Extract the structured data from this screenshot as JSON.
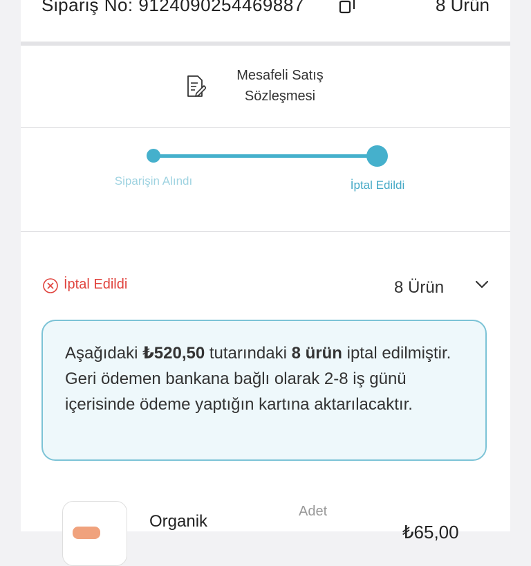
{
  "order": {
    "number_label": "Sipariş No: 9124090254469887",
    "item_count": "8 Ürün",
    "copy_icon": "copy-icon"
  },
  "contract": {
    "icon": "document-edit-icon",
    "label": "Mesafeli Satış Sözleşmesi"
  },
  "progress": {
    "step1": "Siparişin Alındı",
    "step2": "İptal Edildi",
    "accent": "#45b0cc"
  },
  "status": {
    "icon": "cancel-circle-icon",
    "label": "İptal Edildi",
    "count": "8 Ürün",
    "chevron_icon": "chevron-down-icon",
    "color": "#e0433d"
  },
  "info": {
    "pre": "Aşağıdaki",
    "amount": "₺520,50",
    "mid": "tutarındaki",
    "items": "8 ürün",
    "post": "iptal edilmiştir. Geri ödemen bankana bağlı olarak 2-8 iş günü içerisinde ödeme yaptığın kartına aktarılacaktır."
  },
  "product": {
    "name": "Organik",
    "qty_label": "Adet",
    "price": "₺65,00"
  }
}
